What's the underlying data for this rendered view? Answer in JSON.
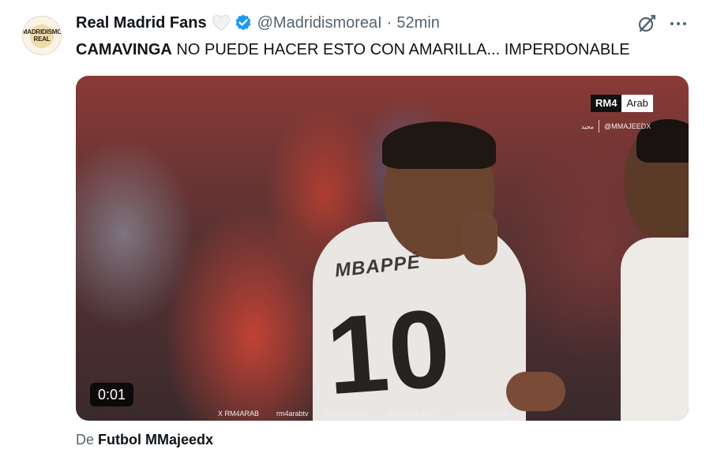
{
  "author": {
    "avatar_lines": [
      "MADRIDISMO",
      "REAL"
    ],
    "name": "Real Madrid Fans",
    "handle": "@MadridismoreaI",
    "separator": "·",
    "time": "52min"
  },
  "tweet": {
    "text_bold": "CAMAVINGA",
    "text_rest": " NO PUEDE HACER ESTO CON AMARILLA... IMPERDONABLE"
  },
  "media": {
    "watermark_brand": "RM4",
    "watermark_brand_suffix": "Arab",
    "channel_arabic": "مجيد",
    "channel_handle": "@MMAJEEDX",
    "jersey_name": "MBAPPÉ",
    "jersey_number": "10",
    "duration": "0:01",
    "socials": [
      "X RM4ARAB",
      "rm4arabtv",
      "RM4ArabLive",
      "MALARAB.NET1",
      "RM4ArabOfficial"
    ]
  },
  "attribution": {
    "prefix": "De ",
    "source": "Futbol MMajeedx"
  },
  "icons": {
    "verified": "verified-badge-icon",
    "heart": "white-heart-icon",
    "grok": "grok-icon",
    "more": "more-options-icon"
  },
  "colors": {
    "verified": "#1d9bf0",
    "secondary_text": "#536471",
    "primary_text": "#0f1419"
  }
}
